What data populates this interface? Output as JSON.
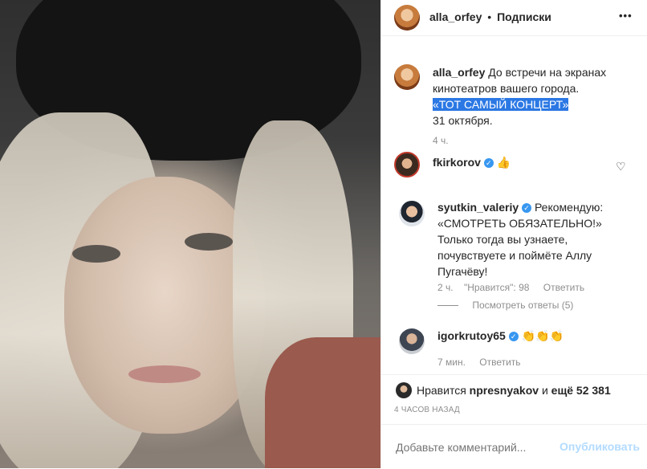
{
  "header": {
    "username": "alla_orfey",
    "separator": "•",
    "follow_label": "Подписки",
    "more_icon": "•••"
  },
  "caption": {
    "username": "alla_orfey",
    "text_1": "До встречи на экранах",
    "text_2": "кинотеатров вашего города.",
    "highlight": "«ТОТ САМЫЙ КОНЦЕРТ»",
    "text_3": "31 октября.",
    "time": "4 ч."
  },
  "comments": [
    {
      "username": "fkirkorov",
      "verified": true,
      "text": "👍"
    },
    {
      "username": "syutkin_valeriy",
      "verified": true,
      "text_lines": [
        "Рекомендую:",
        "«СМОТРЕТЬ ОБЯЗАТЕЛЬНО!»",
        "Только тогда вы узнаете,",
        "почувствуете и поймёте Аллу",
        "Пугачёву!"
      ],
      "time": "2 ч.",
      "likes": "\"Нравится\": 98",
      "reply": "Ответить",
      "view_replies": "Посмотреть ответы (5)"
    },
    {
      "username": "igorkrutoy65",
      "verified": true,
      "text": "👏👏👏",
      "time": "7 мин.",
      "reply": "Ответить"
    }
  ],
  "likes_line": {
    "prefix": "Нравится",
    "user": "npresnyakov",
    "middle": "и",
    "rest": "ещё 52 381"
  },
  "post_time": "4 ЧАСОВ НАЗАД",
  "comment_input": {
    "placeholder": "Добавьте комментарий...",
    "publish": "Опубликовать"
  },
  "colors": {
    "link_blue": "#3897f0",
    "muted": "#8e8e8e",
    "highlight_bg": "#2b78e4"
  }
}
